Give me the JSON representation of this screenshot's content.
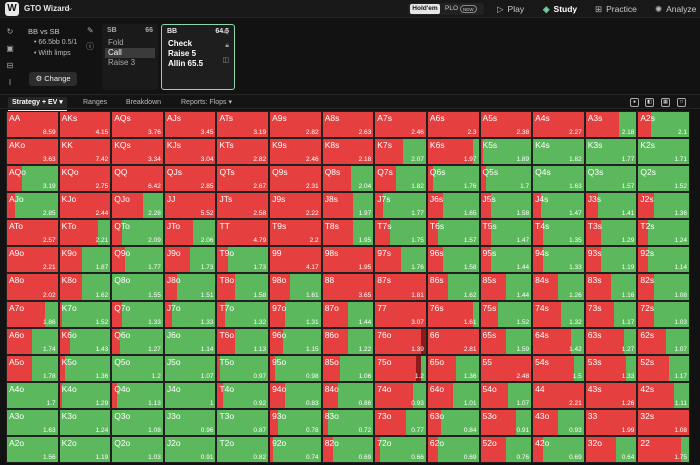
{
  "app": {
    "logo_letter": "W",
    "name": "GTO Wizard"
  },
  "mode": {
    "holdem": "Hold'em",
    "plo": "PLO",
    "plo_badge": "NEW"
  },
  "nav": [
    {
      "label": "Play",
      "icon": "play-icon"
    },
    {
      "label": "Study",
      "icon": "study-layers-icon",
      "active": true
    },
    {
      "label": "Practice",
      "icon": "gamepad-icon"
    },
    {
      "label": "Analyze",
      "icon": "analyze-icon"
    }
  ],
  "game": {
    "title": "BB vs SB",
    "stack_info": "66.5bb 0.5/1",
    "limps": "With limps",
    "change_label": "Change"
  },
  "sb_card": {
    "pos": "SB",
    "stack": "66",
    "actions": [
      "Fold",
      "Call",
      "Raise 3"
    ],
    "selected": 1
  },
  "bb_card": {
    "pos": "BB",
    "stack": "64.5",
    "actions": [
      "Check",
      "Raise 5",
      "Allin 65.5"
    ]
  },
  "tabs": [
    "Strategy + EV",
    "Ranges",
    "Breakdown",
    "Reports: Flops"
  ],
  "colors": {
    "raise": "#e5403f",
    "check": "#5cb85c",
    "allin": "#8c1c1c",
    "card_border": "#8fd6a8"
  },
  "ranks": [
    "A",
    "K",
    "Q",
    "J",
    "T",
    "9",
    "8",
    "7",
    "6",
    "5",
    "4",
    "3",
    "2"
  ],
  "grid": {
    "rows": [
      [
        [
          "AA",
          "8.59",
          1,
          0,
          0
        ],
        [
          "AKs",
          "4.15",
          1,
          0,
          0
        ],
        [
          "AQs",
          "3.76",
          1,
          0,
          0
        ],
        [
          "AJs",
          "3.45",
          1,
          0,
          0
        ],
        [
          "ATs",
          "3.19",
          1,
          0,
          0
        ],
        [
          "A9s",
          "2.82",
          1,
          0,
          0
        ],
        [
          "A8s",
          "2.63",
          1,
          0,
          0
        ],
        [
          "A7s",
          "2.46",
          1,
          0,
          0
        ],
        [
          "A6s",
          "2.3",
          1,
          0,
          0
        ],
        [
          "A5s",
          "2.38",
          1,
          0,
          0
        ],
        [
          "A4s",
          "2.27",
          1,
          0,
          0
        ],
        [
          "A3s",
          "2.18",
          0.65,
          0,
          0.35
        ],
        [
          "A2s",
          "2.1",
          0.25,
          0,
          0.75
        ]
      ],
      [
        [
          "AKo",
          "3.63",
          1,
          0,
          0
        ],
        [
          "KK",
          "7.42",
          1,
          0,
          0
        ],
        [
          "KQs",
          "3.34",
          1,
          0,
          0
        ],
        [
          "KJs",
          "3.04",
          1,
          0,
          0
        ],
        [
          "KTs",
          "2.82",
          1,
          0,
          0
        ],
        [
          "K9s",
          "2.46",
          1,
          0,
          0
        ],
        [
          "K8s",
          "2.18",
          1,
          0,
          0
        ],
        [
          "K7s",
          "2.07",
          0.55,
          0,
          0.45
        ],
        [
          "K6s",
          "1.97",
          0.9,
          0,
          0.1
        ],
        [
          "K5s",
          "1.89",
          0.05,
          0,
          0.95
        ],
        [
          "K4s",
          "1.82",
          0,
          0,
          1
        ],
        [
          "K3s",
          "1.77",
          0,
          0,
          1
        ],
        [
          "K2s",
          "1.71",
          0,
          0,
          1
        ]
      ],
      [
        [
          "AQo",
          "3.19",
          0.3,
          0,
          0.7
        ],
        [
          "KQo",
          "2.75",
          1,
          0,
          0
        ],
        [
          "QQ",
          "6.42",
          1,
          0,
          0
        ],
        [
          "QJs",
          "2.85",
          1,
          0,
          0
        ],
        [
          "QTs",
          "2.67",
          1,
          0,
          0
        ],
        [
          "Q9s",
          "2.31",
          1,
          0,
          0
        ],
        [
          "Q8s",
          "2.04",
          0.55,
          0,
          0.45
        ],
        [
          "Q7s",
          "1.82",
          0.4,
          0,
          0.6
        ],
        [
          "Q6s",
          "1.76",
          0.1,
          0,
          0.9
        ],
        [
          "Q5s",
          "1.7",
          0.1,
          0,
          0.9
        ],
        [
          "Q4s",
          "1.63",
          0,
          0,
          1
        ],
        [
          "Q3s",
          "1.57",
          0,
          0,
          1
        ],
        [
          "Q2s",
          "1.52",
          0,
          0,
          1
        ]
      ],
      [
        [
          "AJo",
          "2.85",
          0.15,
          0,
          0.85
        ],
        [
          "KJo",
          "2.44",
          1,
          0,
          0
        ],
        [
          "QJo",
          "2.28",
          0.6,
          0,
          0.4
        ],
        [
          "JJ",
          "5.52",
          1,
          0,
          0
        ],
        [
          "JTs",
          "2.58",
          1,
          0,
          0
        ],
        [
          "J9s",
          "2.22",
          1,
          0,
          0
        ],
        [
          "J8s",
          "1.97",
          0.6,
          0,
          0.4
        ],
        [
          "J7s",
          "1.77",
          0.15,
          0,
          0.85
        ],
        [
          "J6s",
          "1.65",
          0.3,
          0,
          0.7
        ],
        [
          "J5s",
          "1.58",
          0.2,
          0,
          0.8
        ],
        [
          "J4s",
          "1.47",
          0.15,
          0,
          0.85
        ],
        [
          "J3s",
          "1.41",
          0.25,
          0,
          0.75
        ],
        [
          "J2s",
          "1.36",
          0.3,
          0,
          0.7
        ]
      ],
      [
        [
          "ATo",
          "2.57",
          1,
          0,
          0
        ],
        [
          "KTo",
          "2.21",
          0.75,
          0,
          0.25
        ],
        [
          "QTo",
          "2.09",
          0.2,
          0,
          0.8
        ],
        [
          "JTo",
          "2.06",
          0.55,
          0,
          0.45
        ],
        [
          "TT",
          "4.79",
          1,
          0,
          0
        ],
        [
          "T9s",
          "2.2",
          1,
          0,
          0
        ],
        [
          "T8s",
          "1.95",
          0.6,
          0,
          0.4
        ],
        [
          "T7s",
          "1.75",
          0.3,
          0,
          0.7
        ],
        [
          "T6s",
          "1.57",
          0.2,
          0,
          0.8
        ],
        [
          "T5s",
          "1.47",
          0.2,
          0,
          0.8
        ],
        [
          "T4s",
          "1.35",
          0.2,
          0,
          0.8
        ],
        [
          "T3s",
          "1.29",
          0.3,
          0,
          0.7
        ],
        [
          "T2s",
          "1.24",
          0.2,
          0,
          0.8
        ]
      ],
      [
        [
          "A9o",
          "2.21",
          1,
          0,
          0
        ],
        [
          "K9o",
          "1.87",
          0.45,
          0,
          0.55
        ],
        [
          "Q9o",
          "1.77",
          0.25,
          0,
          0.75
        ],
        [
          "J9o",
          "1.73",
          0.5,
          0,
          0.5
        ],
        [
          "T9o",
          "1.73",
          0.2,
          0,
          0.8
        ],
        [
          "99",
          "4.17",
          1,
          0,
          0
        ],
        [
          "98s",
          "1.95",
          1,
          0,
          0
        ],
        [
          "97s",
          "1.76",
          0.5,
          0,
          0.5
        ],
        [
          "96s",
          "1.58",
          0.3,
          0,
          0.7
        ],
        [
          "95s",
          "1.44",
          0.2,
          0,
          0.8
        ],
        [
          "94s",
          "1.33",
          0.2,
          0,
          0.8
        ],
        [
          "93s",
          "1.19",
          0.3,
          0,
          0.7
        ],
        [
          "92s",
          "1.14",
          0.2,
          0,
          0.8
        ]
      ],
      [
        [
          "A8o",
          "2.02",
          1,
          0,
          0
        ],
        [
          "K8o",
          "1.62",
          0.45,
          0,
          0.55
        ],
        [
          "Q8o",
          "1.55",
          0,
          0,
          1
        ],
        [
          "J8o",
          "1.51",
          0.25,
          0,
          0.75
        ],
        [
          "T8o",
          "1.58",
          0.35,
          0,
          0.65
        ],
        [
          "98o",
          "1.61",
          0.4,
          0,
          0.6
        ],
        [
          "88",
          "3.65",
          1,
          0,
          0
        ],
        [
          "87s",
          "1.81",
          1,
          0,
          0
        ],
        [
          "86s",
          "1.62",
          0.4,
          0,
          0.6
        ],
        [
          "85s",
          "1.44",
          0.5,
          0,
          0.5
        ],
        [
          "84s",
          "1.26",
          0.5,
          0,
          0.5
        ],
        [
          "83s",
          "1.16",
          0.5,
          0,
          0.5
        ],
        [
          "82s",
          "1.08",
          0.3,
          0,
          0.7
        ]
      ],
      [
        [
          "A7o",
          "1.86",
          0.75,
          0,
          0.25
        ],
        [
          "K7o",
          "1.52",
          0.05,
          0,
          0.95
        ],
        [
          "Q7o",
          "1.33",
          0.2,
          0,
          0.8
        ],
        [
          "J7o",
          "1.33",
          0.15,
          0,
          0.85
        ],
        [
          "T7o",
          "1.32",
          0.15,
          0,
          0.85
        ],
        [
          "97o",
          "1.31",
          0.3,
          0,
          0.7
        ],
        [
          "87o",
          "1.44",
          0.5,
          0,
          0.5
        ],
        [
          "77",
          "3.07",
          1,
          0,
          0
        ],
        [
          "76s",
          "1.61",
          0.9,
          0,
          0.1
        ],
        [
          "75s",
          "1.52",
          0.35,
          0,
          0.65
        ],
        [
          "74s",
          "1.32",
          0.55,
          0,
          0.45
        ],
        [
          "73s",
          "1.17",
          0.55,
          0,
          0.45
        ],
        [
          "72s",
          "1.03",
          0.3,
          0,
          0.7
        ]
      ],
      [
        [
          "A6o",
          "1.74",
          0.5,
          0,
          0.5
        ],
        [
          "K6o",
          "1.43",
          0.2,
          0,
          0.8
        ],
        [
          "Q6o",
          "1.27",
          0.15,
          0,
          0.85
        ],
        [
          "J6o",
          "1.14",
          0,
          0,
          1
        ],
        [
          "T6o",
          "1.13",
          0.35,
          0,
          0.65
        ],
        [
          "96o",
          "1.15",
          0.25,
          0,
          0.75
        ],
        [
          "86o",
          "1.22",
          0.5,
          0,
          0.5
        ],
        [
          "76o",
          "1.39",
          0.9,
          0.1,
          0
        ],
        [
          "66",
          "2.81",
          1,
          0,
          0
        ],
        [
          "65s",
          "1.59",
          0.5,
          0,
          0.5
        ],
        [
          "64s",
          "1.42",
          0.75,
          0,
          0.25
        ],
        [
          "63s",
          "1.27",
          0.75,
          0,
          0.25
        ],
        [
          "62s",
          "1.07",
          0.55,
          0,
          0.45
        ]
      ],
      [
        [
          "A5o",
          "1.78",
          0.5,
          0,
          0.5
        ],
        [
          "K5o",
          "1.36",
          0.1,
          0,
          0.9
        ],
        [
          "Q5o",
          "1.2",
          0,
          0,
          1
        ],
        [
          "J5o",
          "1.07",
          0,
          0,
          1
        ],
        [
          "T5o",
          "0.97",
          0.05,
          0,
          0.95
        ],
        [
          "95o",
          "0.98",
          0.1,
          0,
          0.9
        ],
        [
          "85o",
          "1.06",
          0.35,
          0,
          0.65
        ],
        [
          "75o",
          "1.2",
          0.8,
          0.1,
          0.1
        ],
        [
          "65o",
          "1.36",
          0.55,
          0,
          0.45
        ],
        [
          "55",
          "2.48",
          1,
          0,
          0
        ],
        [
          "54s",
          "1.5",
          0.8,
          0,
          0.2
        ],
        [
          "53s",
          "1.33",
          0.8,
          0,
          0.2
        ],
        [
          "52s",
          "1.17",
          0.6,
          0,
          0.4
        ]
      ],
      [
        [
          "A4o",
          "1.7",
          0,
          0,
          1
        ],
        [
          "K4o",
          "1.29",
          0.05,
          0,
          0.95
        ],
        [
          "Q4o",
          "1.13",
          0.1,
          0,
          0.9
        ],
        [
          "J4o",
          "1",
          0,
          0,
          1
        ],
        [
          "T4o",
          "0.92",
          0.1,
          0,
          0.9
        ],
        [
          "94o",
          "0.83",
          0.3,
          0,
          0.7
        ],
        [
          "84o",
          "0.86",
          0.3,
          0,
          0.7
        ],
        [
          "74o",
          "0.93",
          0.75,
          0,
          0.25
        ],
        [
          "64o",
          "1.01",
          0.5,
          0,
          0.5
        ],
        [
          "54o",
          "1.07",
          0.55,
          0,
          0.45
        ],
        [
          "44",
          "2.21",
          1,
          0,
          0
        ],
        [
          "43s",
          "1.26",
          1,
          0,
          0
        ],
        [
          "42s",
          "1.11",
          0.7,
          0,
          0.3
        ]
      ],
      [
        [
          "A3o",
          "1.63",
          0,
          0,
          1
        ],
        [
          "K3o",
          "1.24",
          0,
          0,
          1
        ],
        [
          "Q3o",
          "1.08",
          0,
          0,
          1
        ],
        [
          "J3o",
          "0.96",
          0,
          0,
          1
        ],
        [
          "T3o",
          "0.87",
          0,
          0,
          1
        ],
        [
          "93o",
          "0.78",
          0.15,
          0,
          0.85
        ],
        [
          "83o",
          "0.72",
          0.1,
          0,
          0.9
        ],
        [
          "73o",
          "0.77",
          0.6,
          0,
          0.4
        ],
        [
          "63o",
          "0.84",
          0.25,
          0,
          0.75
        ],
        [
          "53o",
          "0.91",
          0.7,
          0,
          0.3
        ],
        [
          "43o",
          "0.93",
          0.5,
          0,
          0.5
        ],
        [
          "33",
          "1.99",
          1,
          0,
          0
        ],
        [
          "32s",
          "1.08",
          1,
          0,
          0
        ]
      ],
      [
        [
          "A2o",
          "1.56",
          0,
          0,
          1
        ],
        [
          "K2o",
          "1.19",
          0,
          0,
          1
        ],
        [
          "Q2o",
          "1.03",
          0,
          0,
          1
        ],
        [
          "J2o",
          "0.91",
          0,
          0,
          1
        ],
        [
          "T2o",
          "0.82",
          0,
          0,
          1
        ],
        [
          "92o",
          "0.74",
          0.05,
          0,
          0.95
        ],
        [
          "82o",
          "0.69",
          0.2,
          0,
          0.8
        ],
        [
          "72o",
          "0.66",
          0.1,
          0,
          0.9
        ],
        [
          "62o",
          "0.69",
          0.2,
          0,
          0.8
        ],
        [
          "52o",
          "0.76",
          0.5,
          0,
          0.5
        ],
        [
          "42o",
          "0.69",
          0.2,
          0,
          0.8
        ],
        [
          "32o",
          "0.64",
          0.6,
          0,
          0.4
        ],
        [
          "22",
          "1.75",
          0.85,
          0,
          0.15
        ]
      ]
    ]
  }
}
